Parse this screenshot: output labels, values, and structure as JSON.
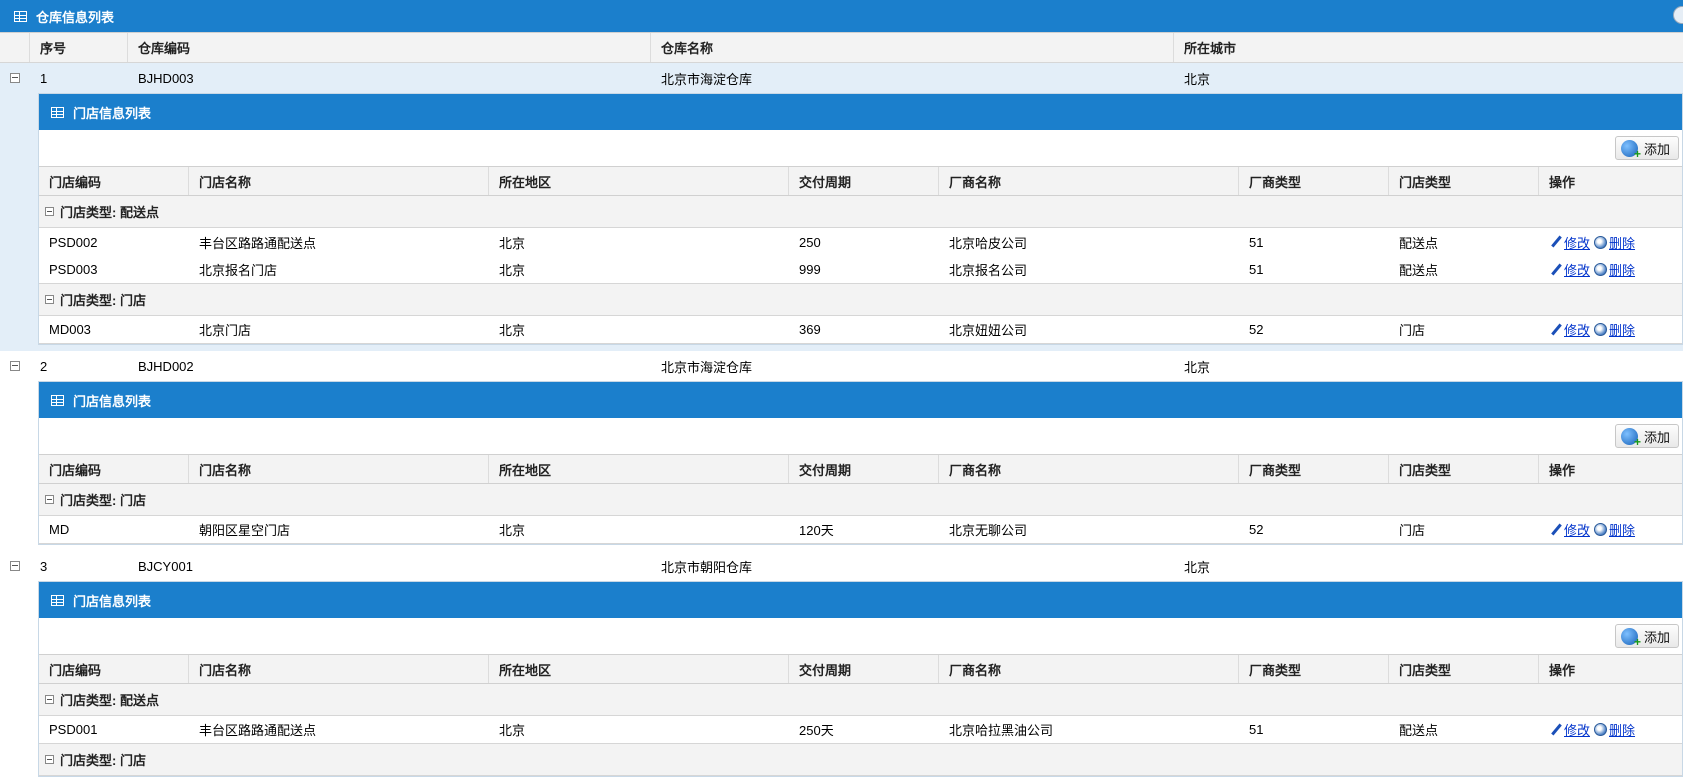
{
  "panel": {
    "title": "仓库信息列表"
  },
  "columns": {
    "num": "序号",
    "code": "仓库编码",
    "name": "仓库名称",
    "city": "所在城市"
  },
  "sub_panel_title": "门店信息列表",
  "add_label": "添加",
  "sub_columns": [
    "门店编码",
    "门店名称",
    "所在地区",
    "交付周期",
    "厂商名称",
    "厂商类型",
    "门店类型",
    "操作"
  ],
  "edit_label": "修改",
  "delete_label": "删除",
  "warehouses": [
    {
      "num": "1",
      "code": "BJHD003",
      "name": "北京市海淀仓库",
      "city": "北京",
      "groups": [
        {
          "label": "门店类型: 配送点",
          "stores": [
            [
              "PSD002",
              "丰台区路路通配送点",
              "北京",
              "250",
              "北京哈皮公司",
              "51",
              "配送点"
            ],
            [
              "PSD003",
              "北京报名门店",
              "北京",
              "999",
              "北京报名公司",
              "51",
              "配送点"
            ]
          ]
        },
        {
          "label": "门店类型: 门店",
          "stores": [
            [
              "MD003",
              "北京门店",
              "北京",
              "369",
              "北京妞妞公司",
              "52",
              "门店"
            ]
          ]
        }
      ]
    },
    {
      "num": "2",
      "code": "BJHD002",
      "name": "北京市海淀仓库",
      "city": "北京",
      "groups": [
        {
          "label": "门店类型: 门店",
          "stores": [
            [
              "MD",
              "朝阳区星空门店",
              "北京",
              "120天",
              "北京无聊公司",
              "52",
              "门店"
            ]
          ]
        }
      ]
    },
    {
      "num": "3",
      "code": "BJCY001",
      "name": "北京市朝阳仓库",
      "city": "北京",
      "groups": [
        {
          "label": "门店类型: 配送点",
          "stores": [
            [
              "PSD001",
              "丰台区路路通配送点",
              "北京",
              "250天",
              "北京哈拉黑油公司",
              "51",
              "配送点"
            ]
          ]
        },
        {
          "label": "门店类型: 门店",
          "stores": []
        }
      ]
    }
  ]
}
